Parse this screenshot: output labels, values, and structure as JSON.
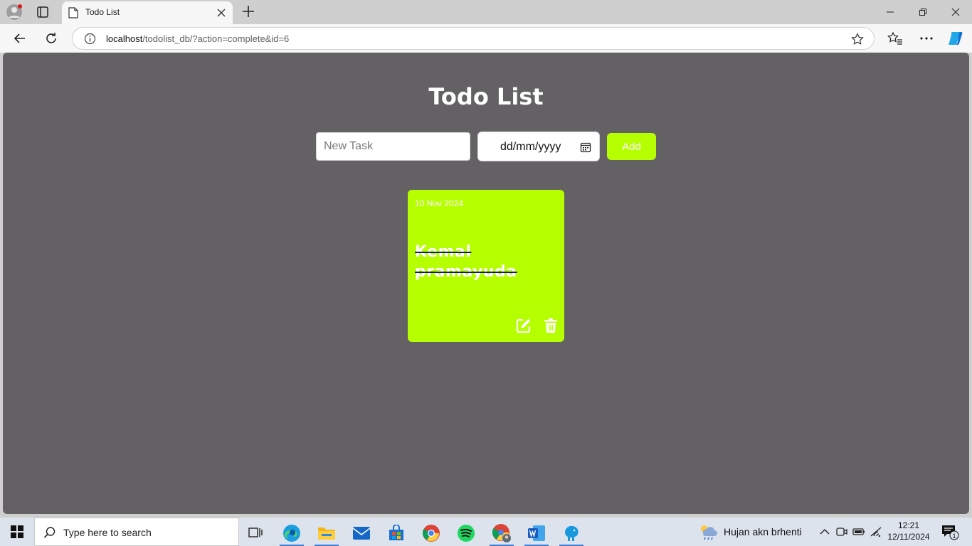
{
  "browser": {
    "tab_title": "Todo List",
    "url_host": "localhost",
    "url_path": "/todolist_db/?action=complete&id=6"
  },
  "app": {
    "title": "Todo List",
    "task_placeholder": "New Task",
    "date_placeholder": "dd/mm/yyyy",
    "add_label": "Add",
    "accent_color": "#b5ff00",
    "background_color": "#636163"
  },
  "todos": [
    {
      "date": "10 Nov 2024",
      "text": "Kemal pramayuda",
      "completed": true
    }
  ],
  "taskbar": {
    "search_placeholder": "Type here to search",
    "weather_text": "Hujan akn brhenti",
    "time": "12:21",
    "date": "12/11/2024",
    "notification_count": "1",
    "apps": [
      "task-view",
      "edge",
      "file-explorer",
      "mail",
      "store",
      "chrome",
      "spotify",
      "chrome-profile",
      "word",
      "mysql"
    ]
  }
}
